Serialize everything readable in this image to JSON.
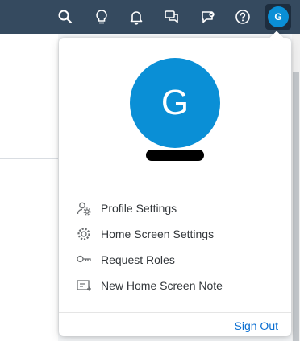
{
  "topbar": {
    "icons": [
      "search-icon",
      "lightbulb-icon",
      "bell-icon",
      "chat-icon",
      "feedback-icon",
      "help-icon"
    ],
    "avatar_initial": "G"
  },
  "profile": {
    "initial": "G"
  },
  "menu": {
    "items": [
      {
        "label": "Profile Settings",
        "icon": "user-settings-icon"
      },
      {
        "label": "Home Screen Settings",
        "icon": "gear-icon"
      },
      {
        "label": "Request Roles",
        "icon": "key-icon"
      },
      {
        "label": "New Home Screen Note",
        "icon": "note-icon"
      }
    ]
  },
  "footer": {
    "sign_out_label": "Sign Out"
  },
  "colors": {
    "shell": "#354a5f",
    "avatar": "#0a8fd6",
    "link": "#0a6ed1"
  }
}
